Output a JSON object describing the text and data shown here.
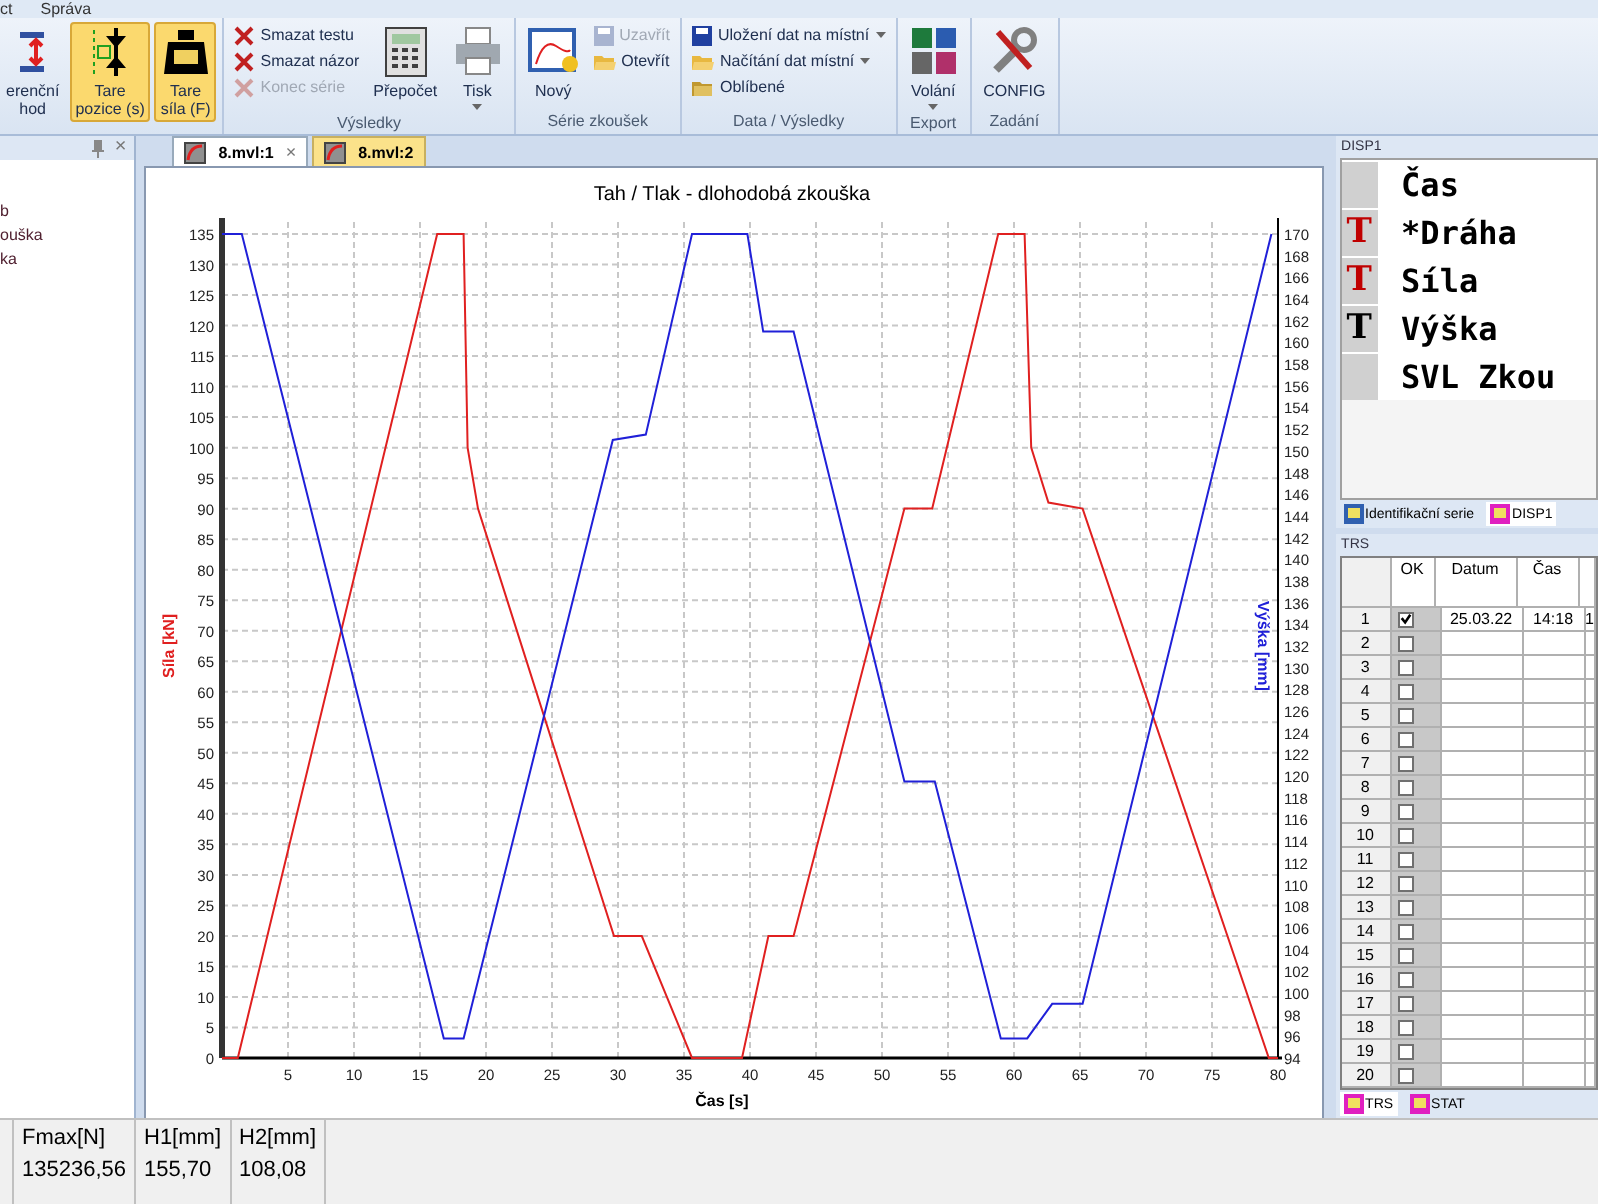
{
  "menu": [
    "ct",
    "Správa"
  ],
  "ribbon": {
    "groups": [
      {
        "items": [
          {
            "kind": "large",
            "lines": [
              "erenční",
              "hod"
            ],
            "selected": false,
            "dropdown": false
          },
          {
            "kind": "large",
            "lines": [
              "Tare",
              "pozice (s)"
            ],
            "selected": true,
            "dropdown": false
          },
          {
            "kind": "large",
            "lines": [
              "Tare",
              "síla (F)"
            ],
            "selected": true,
            "dropdown": false
          }
        ]
      },
      {
        "label": "Výsledky",
        "items": [
          {
            "kind": "stack",
            "items": [
              {
                "label": "Smazat testu",
                "disabled": false,
                "dropdown": false
              },
              {
                "label": "Smazat názor",
                "disabled": false,
                "dropdown": false
              },
              {
                "label": "Konec série",
                "disabled": true,
                "dropdown": false
              }
            ]
          },
          {
            "kind": "large",
            "lines": [
              "Přepočet"
            ],
            "selected": false,
            "dropdown": false
          },
          {
            "kind": "large",
            "lines": [
              "Tisk"
            ],
            "selected": false,
            "dropdown": true
          }
        ]
      },
      {
        "label": "Série zkoušek",
        "items": [
          {
            "kind": "large",
            "lines": [
              "Nový"
            ],
            "selected": false,
            "dropdown": false
          },
          {
            "kind": "stack",
            "items": [
              {
                "label": "Uzavřít",
                "disabled": true,
                "dropdown": false
              },
              {
                "label": "Otevřít",
                "disabled": false,
                "dropdown": false
              }
            ]
          }
        ]
      },
      {
        "label": "Data / Výsledky",
        "items": [
          {
            "kind": "stack",
            "items": [
              {
                "label": "Uložení dat na místní",
                "disabled": false,
                "dropdown": true
              },
              {
                "label": "Načítání dat místní",
                "disabled": false,
                "dropdown": true
              },
              {
                "label": "Oblíbené",
                "disabled": false,
                "dropdown": false
              }
            ]
          }
        ]
      },
      {
        "label": "Export",
        "items": [
          {
            "kind": "large",
            "lines": [
              "Volání"
            ],
            "selected": false,
            "dropdown": true
          }
        ]
      },
      {
        "label": "Zadání",
        "items": [
          {
            "kind": "large",
            "lines": [
              "CONFIG"
            ],
            "selected": false,
            "dropdown": false
          }
        ]
      }
    ]
  },
  "sidebar": {
    "close": "×",
    "items": [
      "b",
      "ouška",
      "ka"
    ]
  },
  "document": {
    "tabs": [
      {
        "label": "8.mvl:1",
        "selected": true,
        "close": "×"
      },
      {
        "label": "8.mvl:2",
        "selected": false
      }
    ],
    "chart": {
      "chart_data": {
        "type": "line",
        "title": "Tah / Tlak - dlohodobá zkouška",
        "xlabel": "Čas [s]",
        "ylabel": "Síla [kN]",
        "y2label": "Výška [mm]",
        "xlim": [
          0,
          80
        ],
        "ylim": [
          0,
          135
        ],
        "y2lim": [
          94,
          170
        ],
        "xticks": [
          5,
          10,
          15,
          20,
          25,
          30,
          35,
          40,
          45,
          50,
          55,
          60,
          65,
          70,
          75,
          80
        ],
        "yticks": [
          0,
          5,
          10,
          15,
          20,
          25,
          30,
          35,
          40,
          45,
          50,
          55,
          60,
          65,
          70,
          75,
          80,
          85,
          90,
          95,
          100,
          105,
          110,
          115,
          120,
          125,
          130,
          135
        ],
        "y2ticks": [
          {
            "value": 94,
            "label": "94"
          },
          96,
          98,
          100,
          102,
          104,
          106,
          108,
          110,
          112,
          114,
          116,
          118,
          120,
          122,
          124,
          126,
          128,
          130,
          132,
          134,
          136,
          138,
          140,
          142,
          144,
          146,
          148,
          150,
          152,
          154,
          156,
          158,
          160,
          162,
          164,
          166,
          168,
          170
        ],
        "series": [
          {
            "color": "#e02020",
            "x": [
              0,
              1.2,
              16.3,
              18.3,
              18.6,
              19.4,
              29.7,
              31.8,
              35.6,
              39.4,
              41.4,
              43.3,
              51.7,
              53.8,
              58.8,
              60.8,
              61.3,
              62.6,
              65.2,
              79.3,
              80
            ],
            "values": [
              0,
              0,
              135,
              135,
              100,
              90,
              20,
              20,
              0,
              0,
              20,
              20,
              90,
              90,
              135,
              135,
              100,
              91,
              90,
              0,
              0
            ]
          },
          {
            "color": "#2020d8",
            "axis": "y2",
            "x": [
              0,
              1.5,
              16.8,
              18.3,
              29.6,
              32.1,
              35.6,
              39.8,
              41.0,
              43.3,
              51.7,
              54.0,
              59.0,
              61.0,
              62.9,
              65.2,
              79.5
            ],
            "values": [
              170,
              170,
              95.8,
              95.8,
              151,
              151.5,
              170,
              170,
              161,
              161,
              119.5,
              119.5,
              95.8,
              95.8,
              99,
              99,
              170
            ]
          }
        ],
        "grid": true
      }
    }
  },
  "disp_panel": {
    "title": "DISP1",
    "rows": [
      {
        "mark": "",
        "label": "Čas"
      },
      {
        "mark": "T",
        "color": "#c00000",
        "label": "*Dráha"
      },
      {
        "mark": "T",
        "color": "#c00000",
        "label": "Síla"
      },
      {
        "mark": "T",
        "color": "#000000",
        "label": "Výška"
      },
      {
        "mark": "",
        "label": "SVL Zkou"
      }
    ],
    "tabs": [
      {
        "label": "Identifikační serie",
        "selected": false
      },
      {
        "label": "DISP1",
        "selected": true
      }
    ]
  },
  "trs_panel": {
    "title": "TRS",
    "columns": [
      "OK",
      "Datum",
      "Čas"
    ],
    "rows": [
      {
        "number": "1",
        "ok": true,
        "datum": "25.03.22",
        "cas": "14:18",
        "column_5": "1"
      },
      {
        "number": "2",
        "ok": false
      },
      {
        "number": "3",
        "ok": false
      },
      {
        "number": "4",
        "ok": false
      },
      {
        "number": "5",
        "ok": false
      },
      {
        "number": "6",
        "ok": false
      },
      {
        "number": "7",
        "ok": false
      },
      {
        "number": "8",
        "ok": false
      },
      {
        "number": "9",
        "ok": false
      },
      {
        "number": "10",
        "ok": false
      },
      {
        "number": "11",
        "ok": false
      },
      {
        "number": "12",
        "ok": false
      },
      {
        "number": "13",
        "ok": false
      },
      {
        "number": "14",
        "ok": false
      },
      {
        "number": "15",
        "ok": false
      },
      {
        "number": "16",
        "ok": false
      },
      {
        "number": "17",
        "ok": false
      },
      {
        "number": "18",
        "ok": false
      },
      {
        "number": "19",
        "ok": false
      },
      {
        "number": "20",
        "ok": false
      }
    ],
    "tabs": [
      {
        "label": "TRS",
        "selected": true
      },
      {
        "label": "STAT",
        "selected": false
      }
    ]
  },
  "status_bar": {
    "columns": [
      {
        "header": "Fmax[N]",
        "value": "135236,56"
      },
      {
        "header": "H1[mm]",
        "value": "155,70"
      },
      {
        "header": "H2[mm]",
        "value": "108,08"
      }
    ]
  }
}
